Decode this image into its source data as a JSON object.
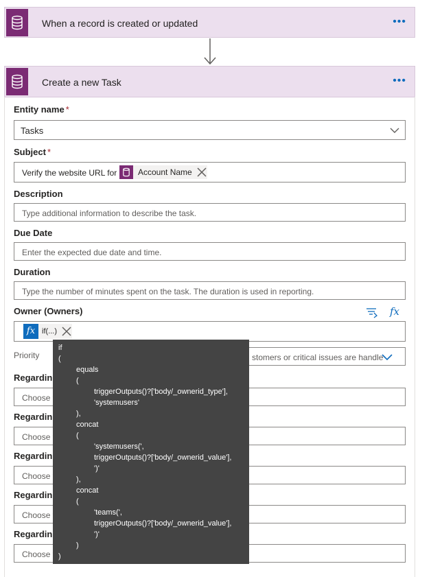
{
  "trigger": {
    "title": "When a record is created or updated",
    "more": "•••"
  },
  "action": {
    "title": "Create a new Task",
    "more": "•••"
  },
  "fields": {
    "entity_name": {
      "label": "Entity name",
      "required": "*",
      "value": "Tasks"
    },
    "subject": {
      "label": "Subject",
      "required": "*",
      "prefix": "Verify the website URL for",
      "token": "Account Name"
    },
    "description": {
      "label": "Description",
      "placeholder": "Type additional information to describe the task."
    },
    "due_date": {
      "label": "Due Date",
      "placeholder": "Enter the expected due date and time."
    },
    "duration": {
      "label": "Duration",
      "placeholder": "Type the number of minutes spent on the task. The duration is used in reporting."
    },
    "owner": {
      "label": "Owner (Owners)",
      "token": "if(...)"
    },
    "priority": {
      "label": "Priority",
      "value_partial": "stomers or critical issues are handle"
    },
    "regarding": [
      {
        "label": "Regardin",
        "placeholder": "Choose t"
      },
      {
        "label": "Regardin",
        "placeholder": "Choose t"
      },
      {
        "label": "Regardin",
        "placeholder": "Choose t"
      },
      {
        "label": "Regardin",
        "placeholder": "Choose t"
      },
      {
        "label": "Regardin",
        "placeholder": "Choose t"
      }
    ]
  },
  "tooltip": {
    "lines": [
      {
        "level": 0,
        "text": "if"
      },
      {
        "level": 0,
        "text": "("
      },
      {
        "level": 1,
        "text": "equals"
      },
      {
        "level": 1,
        "text": "("
      },
      {
        "level": 2,
        "text": "triggerOutputs()?['body/_ownerid_type'],"
      },
      {
        "level": 2,
        "text": "'systemusers'"
      },
      {
        "level": 1,
        "text": "),"
      },
      {
        "level": 1,
        "text": "concat"
      },
      {
        "level": 1,
        "text": "("
      },
      {
        "level": 2,
        "text": "'systemusers(',"
      },
      {
        "level": 2,
        "text": "triggerOutputs()?['body/_ownerid_value'],"
      },
      {
        "level": 2,
        "text": "')'"
      },
      {
        "level": 1,
        "text": "),"
      },
      {
        "level": 1,
        "text": "concat"
      },
      {
        "level": 1,
        "text": "("
      },
      {
        "level": 2,
        "text": "'teams(',"
      },
      {
        "level": 2,
        "text": "triggerOutputs()?['body/_ownerid_value'],"
      },
      {
        "level": 2,
        "text": "')'"
      },
      {
        "level": 1,
        "text": ")"
      },
      {
        "level": 0,
        "text": ")"
      }
    ]
  },
  "colors": {
    "header_bg": "#ecdfee",
    "connector_icon_bg": "#7b2b74",
    "accent_blue": "#0f6cbd",
    "tooltip_bg": "#444444"
  }
}
